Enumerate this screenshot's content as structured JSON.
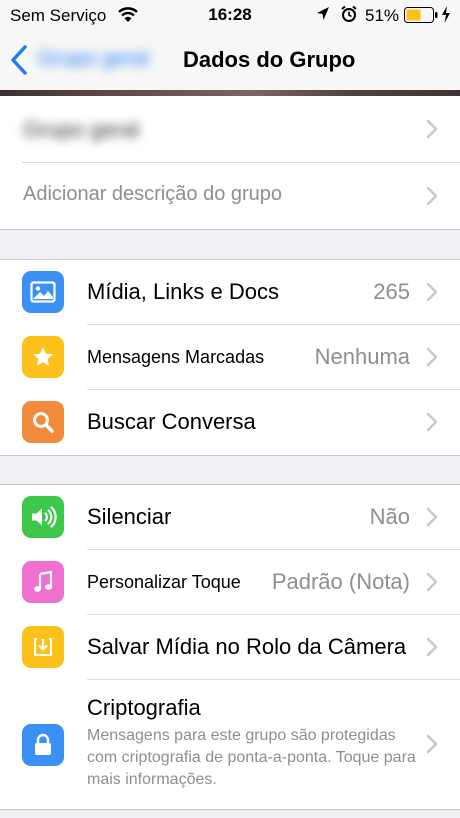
{
  "status_bar": {
    "carrier": "Sem Serviço",
    "time": "16:28",
    "battery": "51%"
  },
  "nav": {
    "back_label": "Grupo geral",
    "title": "Dados do Grupo"
  },
  "group_info": {
    "name": "Grupo geral",
    "description_placeholder": "Adicionar descrição do grupo"
  },
  "actions": [
    {
      "label": "Mídia, Links e Docs",
      "value": "265",
      "icon": "photo-icon",
      "color": "#3b90f3"
    },
    {
      "label": "Mensagens Marcadas",
      "value": "Nenhuma",
      "icon": "star-icon",
      "color": "#fcc21b"
    },
    {
      "label": "Buscar Conversa",
      "value": "",
      "icon": "search-icon",
      "color": "#f18a3a"
    }
  ],
  "settings": [
    {
      "label": "Silenciar",
      "value": "Não",
      "icon": "speaker-icon",
      "color": "#3ec84a"
    },
    {
      "label": "Personalizar Toque",
      "value": "Padrão (Nota)",
      "icon": "music-note-icon",
      "color": "#ef70d0"
    },
    {
      "label": "Salvar Mídia no Rolo da Câmera",
      "value": "",
      "icon": "download-icon",
      "color": "#fcc21b"
    },
    {
      "label": "Criptografia",
      "subtitle": "Mensagens para este grupo são protegidas com criptografia de ponta-a-ponta. Toque para mais informações.",
      "icon": "lock-icon",
      "color": "#3b90f3"
    }
  ]
}
